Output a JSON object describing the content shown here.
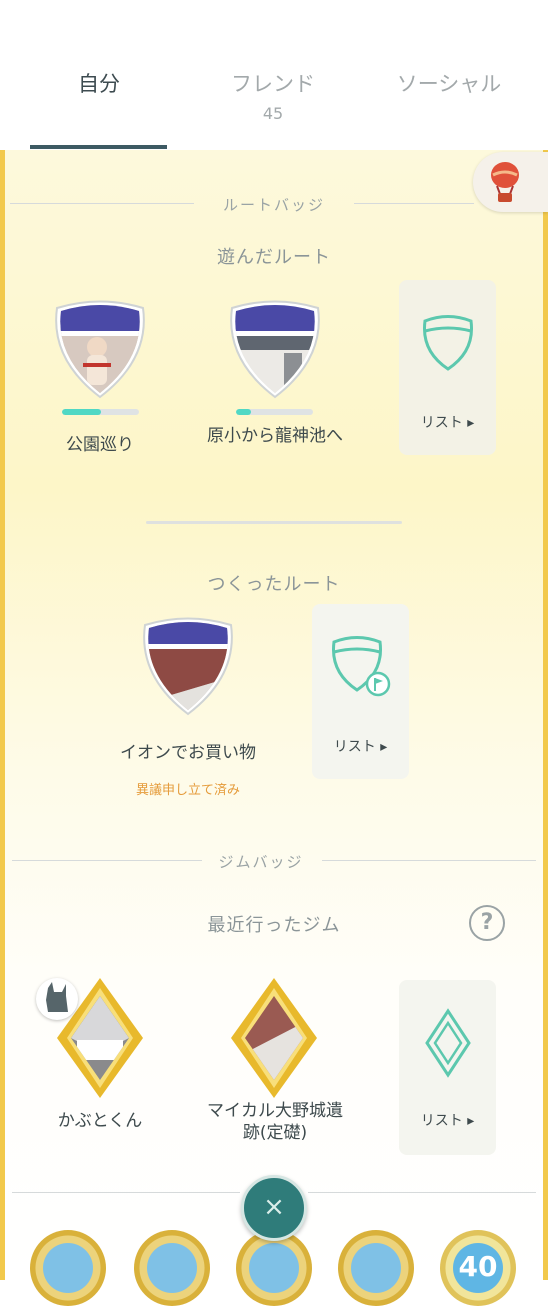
{
  "tabs": [
    {
      "label": "自分",
      "active": true
    },
    {
      "label": "フレンド",
      "count": "45",
      "active": false
    },
    {
      "label": "ソーシャル",
      "active": false
    }
  ],
  "route_badges": {
    "divider": "ルートバッジ",
    "played": {
      "title": "遊んだルート",
      "items": [
        {
          "name": "公園巡り",
          "progress": 0.5
        },
        {
          "name": "原小から龍神池へ",
          "progress": 0.2
        }
      ],
      "list_label": "リスト ▸"
    },
    "created": {
      "title": "つくったルート",
      "items": [
        {
          "name": "イオンでお買い物",
          "status": "異議申し立て済み"
        }
      ],
      "list_label": "リスト ▸"
    }
  },
  "gym_badges": {
    "divider": "ジムバッジ",
    "title": "最近行ったジム",
    "help_label": "?",
    "items": [
      {
        "name": "かぶとくん"
      },
      {
        "name": "マイカル大野城遺跡(定礎)"
      }
    ],
    "list_label": "リスト ▸"
  },
  "bottom": {
    "close_label": "×",
    "medal_level": "40"
  },
  "colors": {
    "accent": "#50d8c4",
    "panel_border": "#f2c94c",
    "objection": "#e59b3a"
  }
}
